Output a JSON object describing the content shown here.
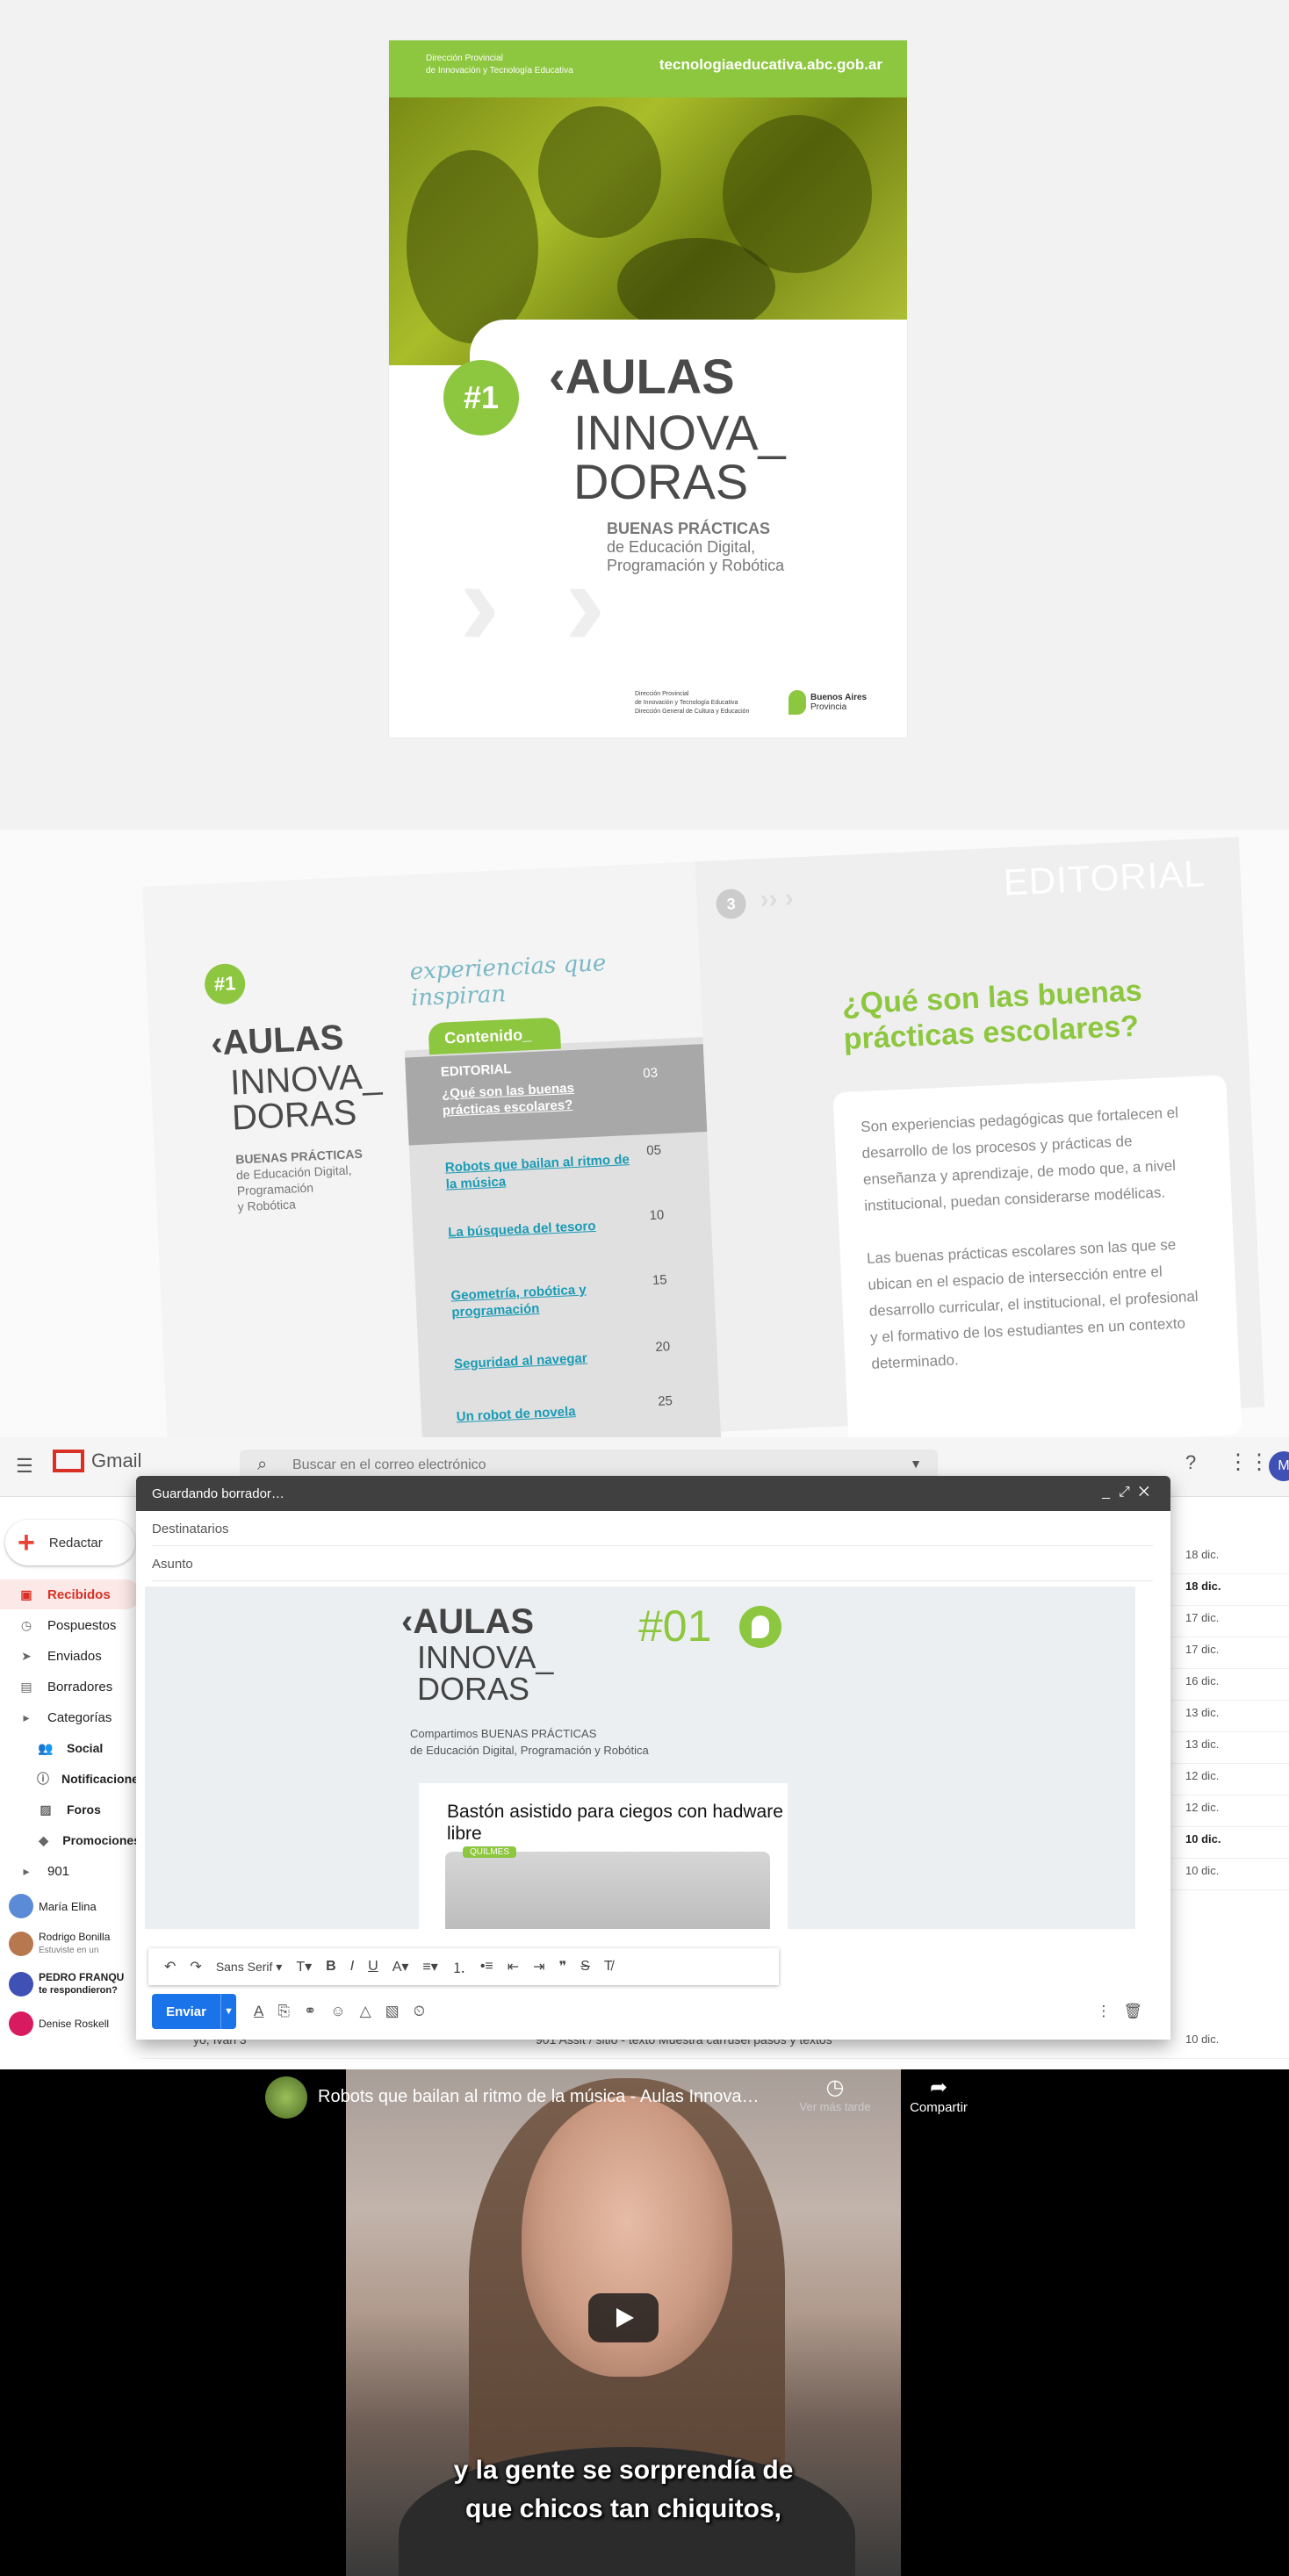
{
  "cover": {
    "institution_line1": "Dirección Provincial",
    "institution_line2": "de Innovación y Tecnología Educativa",
    "url": "tecnologiaeducativa.abc.gob.ar",
    "issue": "#1",
    "title_aulas": "AULAS",
    "title_inno": "INNOVA_",
    "title_doras": "DORAS",
    "subtitle_bold": "BUENAS PRÁCTICAS",
    "subtitle_line2": "de Educación Digital,",
    "subtitle_line3": "Programación y Robótica",
    "footer_line1": "Dirección Provincial",
    "footer_line2": "de Innovación y Tecnología Educativa",
    "footer_line3": "Dirección General de Cultura y Educación",
    "ba_line1": "Buenos Aires",
    "ba_line2": "Provincia"
  },
  "spread": {
    "left_issue": "#1",
    "experiences": "experiencias que inspiran",
    "left_title_aulas": "AULAS",
    "left_title_inno": "INNOVA_",
    "left_title_doras": "DORAS",
    "left_bp": "BUENAS PRÁCTICAS",
    "left_bp2": "de Educación Digital,",
    "left_bp3": "Programación",
    "left_bp4": "y Robótica",
    "toc_header": "Contenido_",
    "toc_editorial": "EDITORIAL",
    "toc": [
      {
        "title": "¿Qué son las buenas prácticas escolares?",
        "page": "03"
      },
      {
        "title": "Robots que bailan al ritmo de la música",
        "page": "05"
      },
      {
        "title": "La búsqueda del tesoro",
        "page": "10"
      },
      {
        "title": "Geometría, robótica y programación",
        "page": "15"
      },
      {
        "title": "Seguridad al navegar",
        "page": "20"
      },
      {
        "title": "Un robot de novela",
        "page": "25"
      }
    ],
    "page_num": "3",
    "editorial": "EDITORIAL",
    "question_line1": "¿Qué son las buenas",
    "question_line2": "prácticas escolares?",
    "para1": "Son experiencias pedagógicas que fortalecen el desarrollo de los procesos y prácticas de enseñanza y aprendizaje, de modo que, a nivel institucional, puedan considerarse modélicas.",
    "para2": "Las buenas prácticas escolares son las que se ubican en el espacio de intersección entre el desarrollo curricular, el institucional, el profesional y el formativo de los estudiantes en un contexto determinado."
  },
  "gmail": {
    "app_name": "Gmail",
    "search_placeholder": "Buscar en el correo electrónico",
    "avatar_letter": "M",
    "compose_label": "Redactar",
    "nav": [
      {
        "label": "Recibidos",
        "icon": "inbox-icon"
      },
      {
        "label": "Pospuestos",
        "icon": "clock-icon"
      },
      {
        "label": "Enviados",
        "icon": "send-icon"
      },
      {
        "label": "Borradores",
        "icon": "draft-icon"
      },
      {
        "label": "Categorías",
        "icon": "label-icon"
      },
      {
        "label": "Social",
        "icon": "people-icon"
      },
      {
        "label": "Notificaciones",
        "icon": "info-icon"
      },
      {
        "label": "Foros",
        "icon": "forum-icon"
      },
      {
        "label": "Promociones",
        "icon": "tag-icon"
      },
      {
        "label": "901",
        "icon": "label-icon"
      }
    ],
    "account": "María Elina",
    "chats": [
      {
        "name": "Rodrigo Bonilla",
        "preview": "Estuviste en un"
      },
      {
        "name": "PEDRO FRANQU",
        "preview": "te respondieron?"
      },
      {
        "name": "Denise Roskell",
        "preview": ""
      }
    ],
    "mail_dates": [
      "18 dic.",
      "18 dic.",
      "17 dic.",
      "17 dic.",
      "16 dic.",
      "13 dic.",
      "13 dic.",
      "12 dic.",
      "12 dic.",
      "10 dic.",
      "10 dic.",
      "10 dic."
    ],
    "last_row_sender": "yo, Ivan 3",
    "last_row_subject": "901 Assit / sitio - texto Muestra carrusel pasos y textos",
    "compose": {
      "window_title": "Guardando borrador…",
      "to_placeholder": "Destinatarios",
      "subject_placeholder": "Asunto",
      "nl_aulas": "AULAS",
      "nl_inno": "INNOVA_",
      "nl_doras": "DORAS",
      "nl_issue": "#01",
      "nl_sub1": "Compartimos BUENAS PRÁCTICAS",
      "nl_sub2": "de Educación Digital, Programación y Robótica",
      "card_title": "Bastón asistido para ciegos con hadware libre",
      "card_tag": "QUILMES",
      "font_name": "Sans Serif",
      "send_label": "Enviar"
    }
  },
  "video": {
    "title": "Robots que bailan al ritmo de la música - Aulas Innova…",
    "watch_later": "Ver más tarde",
    "share": "Compartir",
    "subtitle_line1": "y la gente se sorprendía de",
    "subtitle_line2": "que chicos tan chiquitos,"
  }
}
